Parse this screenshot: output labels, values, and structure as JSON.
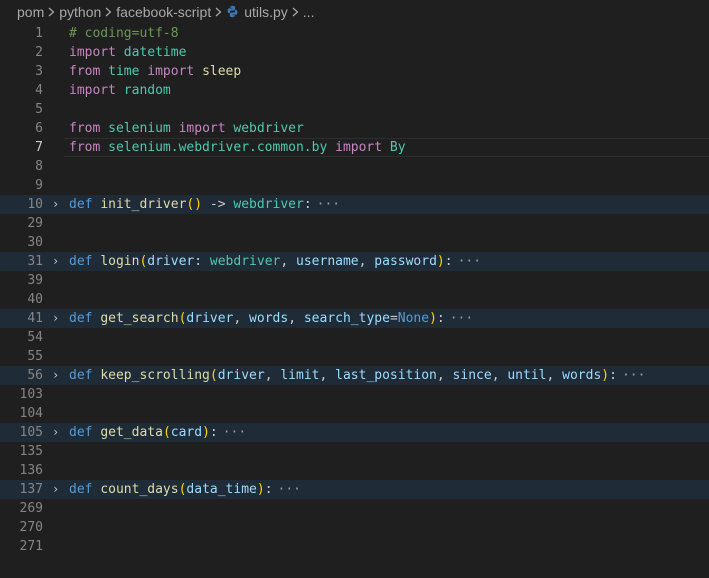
{
  "breadcrumb": {
    "items": [
      "pom",
      "python",
      "facebook-script",
      "utils.py",
      "..."
    ]
  },
  "editor": {
    "lines": [
      {
        "n": "1",
        "tokens": [
          [
            "# coding=utf-8",
            "c-comment"
          ]
        ]
      },
      {
        "n": "2",
        "tokens": [
          [
            "import",
            "c-import"
          ],
          [
            " ",
            ""
          ],
          [
            "datetime",
            "c-module"
          ]
        ]
      },
      {
        "n": "3",
        "tokens": [
          [
            "from",
            "c-import"
          ],
          [
            " ",
            ""
          ],
          [
            "time",
            "c-module"
          ],
          [
            " ",
            ""
          ],
          [
            "import",
            "c-import"
          ],
          [
            " ",
            ""
          ],
          [
            "sleep",
            "c-func"
          ]
        ]
      },
      {
        "n": "4",
        "tokens": [
          [
            "import",
            "c-import"
          ],
          [
            " ",
            ""
          ],
          [
            "random",
            "c-module"
          ]
        ]
      },
      {
        "n": "5",
        "tokens": []
      },
      {
        "n": "6",
        "tokens": [
          [
            "from",
            "c-import"
          ],
          [
            " ",
            ""
          ],
          [
            "selenium",
            "c-module"
          ],
          [
            " ",
            ""
          ],
          [
            "import",
            "c-import"
          ],
          [
            " ",
            ""
          ],
          [
            "webdriver",
            "c-module"
          ]
        ]
      },
      {
        "n": "7",
        "current": true,
        "tokens": [
          [
            "from",
            "c-import"
          ],
          [
            " ",
            ""
          ],
          [
            "selenium.webdriver.common.by",
            "c-module"
          ],
          [
            " ",
            ""
          ],
          [
            "import",
            "c-import"
          ],
          [
            " ",
            ""
          ],
          [
            "By",
            "c-type"
          ]
        ]
      },
      {
        "n": "8",
        "tokens": []
      },
      {
        "n": "9",
        "tokens": []
      },
      {
        "n": "10",
        "folded": true,
        "tokens": [
          [
            "def",
            "c-kw"
          ],
          [
            " ",
            ""
          ],
          [
            "init_driver",
            "c-func"
          ],
          [
            "(",
            "c-bracket1"
          ],
          [
            ")",
            "c-bracket1"
          ],
          [
            " -> ",
            "c-punc"
          ],
          [
            "webdriver",
            "c-module"
          ],
          [
            ":",
            "c-punc"
          ]
        ]
      },
      {
        "n": "29",
        "tokens": []
      },
      {
        "n": "30",
        "tokens": []
      },
      {
        "n": "31",
        "folded": true,
        "tokens": [
          [
            "def",
            "c-kw"
          ],
          [
            " ",
            ""
          ],
          [
            "login",
            "c-func"
          ],
          [
            "(",
            "c-bracket1"
          ],
          [
            "driver",
            "c-param"
          ],
          [
            ": ",
            "c-punc"
          ],
          [
            "webdriver",
            "c-module"
          ],
          [
            ", ",
            "c-punc"
          ],
          [
            "username",
            "c-param"
          ],
          [
            ", ",
            "c-punc"
          ],
          [
            "password",
            "c-param"
          ],
          [
            ")",
            "c-bracket1"
          ],
          [
            ":",
            "c-punc"
          ]
        ]
      },
      {
        "n": "39",
        "tokens": []
      },
      {
        "n": "40",
        "tokens": []
      },
      {
        "n": "41",
        "folded": true,
        "tokens": [
          [
            "def",
            "c-kw"
          ],
          [
            " ",
            ""
          ],
          [
            "get_search",
            "c-func"
          ],
          [
            "(",
            "c-bracket1"
          ],
          [
            "driver",
            "c-param"
          ],
          [
            ", ",
            "c-punc"
          ],
          [
            "words",
            "c-param"
          ],
          [
            ", ",
            "c-punc"
          ],
          [
            "search_type",
            "c-param"
          ],
          [
            "=",
            "c-punc"
          ],
          [
            "None",
            "c-kw"
          ],
          [
            ")",
            "c-bracket1"
          ],
          [
            ":",
            "c-punc"
          ]
        ]
      },
      {
        "n": "54",
        "tokens": []
      },
      {
        "n": "55",
        "tokens": []
      },
      {
        "n": "56",
        "folded": true,
        "tokens": [
          [
            "def",
            "c-kw"
          ],
          [
            " ",
            ""
          ],
          [
            "keep_scrolling",
            "c-func"
          ],
          [
            "(",
            "c-bracket1"
          ],
          [
            "driver",
            "c-param"
          ],
          [
            ", ",
            "c-punc"
          ],
          [
            "limit",
            "c-param"
          ],
          [
            ", ",
            "c-punc"
          ],
          [
            "last_position",
            "c-param"
          ],
          [
            ", ",
            "c-punc"
          ],
          [
            "since",
            "c-param"
          ],
          [
            ", ",
            "c-punc"
          ],
          [
            "until",
            "c-param"
          ],
          [
            ", ",
            "c-punc"
          ],
          [
            "words",
            "c-param"
          ],
          [
            ")",
            "c-bracket1"
          ],
          [
            ":",
            "c-punc"
          ]
        ]
      },
      {
        "n": "103",
        "tokens": []
      },
      {
        "n": "104",
        "tokens": []
      },
      {
        "n": "105",
        "folded": true,
        "tokens": [
          [
            "def",
            "c-kw"
          ],
          [
            " ",
            ""
          ],
          [
            "get_data",
            "c-func"
          ],
          [
            "(",
            "c-bracket1"
          ],
          [
            "card",
            "c-param"
          ],
          [
            ")",
            "c-bracket1"
          ],
          [
            ":",
            "c-punc"
          ]
        ]
      },
      {
        "n": "135",
        "tokens": []
      },
      {
        "n": "136",
        "tokens": []
      },
      {
        "n": "137",
        "folded": true,
        "tokens": [
          [
            "def",
            "c-kw"
          ],
          [
            " ",
            ""
          ],
          [
            "count_days",
            "c-func"
          ],
          [
            "(",
            "c-bracket1"
          ],
          [
            "data_time",
            "c-param"
          ],
          [
            ")",
            "c-bracket1"
          ],
          [
            ":",
            "c-punc"
          ]
        ]
      },
      {
        "n": "269",
        "tokens": []
      },
      {
        "n": "270",
        "tokens": []
      },
      {
        "n": "271",
        "tokens": []
      }
    ],
    "fold_glyph": "›",
    "ellipsis": "···"
  }
}
